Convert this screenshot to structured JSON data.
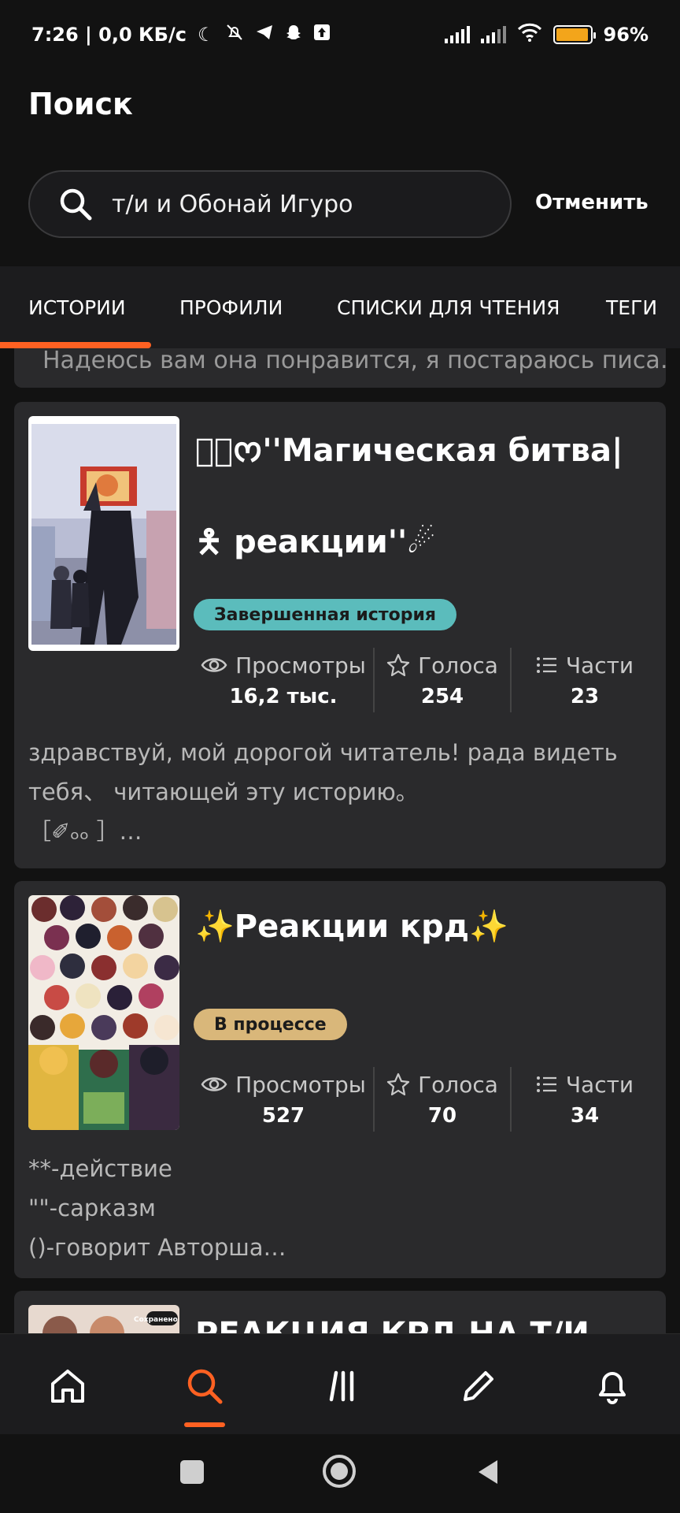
{
  "status_bar": {
    "time_and_speed": "7:26 | 0,0 КБ/с",
    "battery": "96%",
    "battery_level": 0.96
  },
  "header": {
    "title": "Поиск"
  },
  "search": {
    "value": "т/и и Обонай Игуро",
    "cancel_label": "Отменить"
  },
  "tabs": [
    {
      "label": "ИСТОРИИ",
      "active": true
    },
    {
      "label": "ПРОФИЛИ",
      "active": false
    },
    {
      "label": "СПИСКИ ДЛЯ ЧТЕНИЯ",
      "active": false
    },
    {
      "label": "ТЕГИ",
      "active": false
    }
  ],
  "results": {
    "previous_snippet": "Надеюсь вам она понравится, я постараюсь писа…",
    "stories": [
      {
        "title_line1": "ꦿ⃟ᰔ''Магическая битва| 🯅",
        "title_line2": "🯅 реакции''☄",
        "status": "Завершенная история",
        "status_color": "#5bbcbc",
        "views_label": "Просмотры",
        "views": "16,2 тыс.",
        "votes_label": "Голоса",
        "votes": "254",
        "parts_label": "Части",
        "parts": "23",
        "description": "здравствуй, мой дорогой читатель! рада видеть тебя、 читающей эту историю｡\n［✐ₒₒ ］…"
      },
      {
        "title_line1": "✨Реакции крд✨",
        "status": "В процессе",
        "status_color": "#d9b77a",
        "views_label": "Просмотры",
        "views": "527",
        "votes_label": "Голоса",
        "votes": "70",
        "parts_label": "Части",
        "parts": "34",
        "description": "**-действие\n\"\"-сарказм\n()-говорит Авторша…"
      },
      {
        "title_line1": "РЕАКЦИЯ КРД НА Т/И",
        "cover_label": "Сохранено"
      }
    ]
  },
  "bottom_nav": [
    {
      "icon": "home-icon"
    },
    {
      "icon": "search-icon",
      "active": true
    },
    {
      "icon": "library-icon"
    },
    {
      "icon": "pencil-icon"
    },
    {
      "icon": "bell-icon"
    }
  ],
  "colors": {
    "accent": "#ff6122",
    "card": "#2a2a2c",
    "background": "#121212"
  }
}
